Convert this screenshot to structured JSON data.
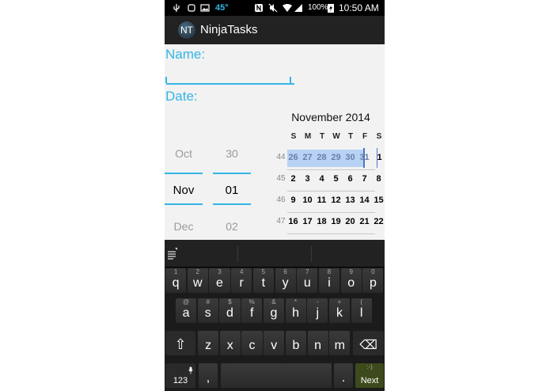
{
  "status_bar": {
    "temperature": "45°",
    "battery": "100%",
    "time": "10:50 AM",
    "icons": [
      "usb-icon",
      "image-icon",
      "nfc-icon",
      "mute-icon",
      "wifi-icon",
      "signal-icon",
      "battery-charging-icon"
    ]
  },
  "action_bar": {
    "icon_text": "NT",
    "title": "NinjaTasks"
  },
  "form": {
    "name_label": "Name:",
    "name_value": "",
    "date_label": "Date:"
  },
  "date_picker": {
    "month": {
      "prev": "Oct",
      "current": "Nov",
      "next": "Dec"
    },
    "day": {
      "prev": "30",
      "current": "01",
      "next": "02"
    }
  },
  "calendar": {
    "title": "November 2014",
    "weekdays": [
      "S",
      "M",
      "T",
      "W",
      "T",
      "F",
      "S"
    ],
    "weeks": [
      {
        "num": "44",
        "days": [
          "26",
          "27",
          "28",
          "29",
          "30",
          "31",
          "1"
        ]
      },
      {
        "num": "45",
        "days": [
          "2",
          "3",
          "4",
          "5",
          "6",
          "7",
          "8"
        ]
      },
      {
        "num": "46",
        "days": [
          "9",
          "10",
          "11",
          "12",
          "13",
          "14",
          "15"
        ]
      },
      {
        "num": "47",
        "days": [
          "16",
          "17",
          "18",
          "19",
          "20",
          "21",
          "22"
        ]
      }
    ],
    "selected_day": "1"
  },
  "keyboard": {
    "row1": [
      {
        "k": "q",
        "a": "1"
      },
      {
        "k": "w",
        "a": "2"
      },
      {
        "k": "e",
        "a": "3"
      },
      {
        "k": "r",
        "a": "4"
      },
      {
        "k": "t",
        "a": "5"
      },
      {
        "k": "y",
        "a": "6"
      },
      {
        "k": "u",
        "a": "7"
      },
      {
        "k": "i",
        "a": "8"
      },
      {
        "k": "o",
        "a": "9"
      },
      {
        "k": "p",
        "a": "0"
      }
    ],
    "row2": [
      {
        "k": "a",
        "a": "@"
      },
      {
        "k": "s",
        "a": "#"
      },
      {
        "k": "d",
        "a": "$"
      },
      {
        "k": "f",
        "a": "%"
      },
      {
        "k": "g",
        "a": "&"
      },
      {
        "k": "h",
        "a": "*"
      },
      {
        "k": "j",
        "a": "-"
      },
      {
        "k": "k",
        "a": "+"
      },
      {
        "k": "l",
        "a": "("
      }
    ],
    "row3": [
      {
        "k": "z",
        "a": ""
      },
      {
        "k": "x",
        "a": ""
      },
      {
        "k": "c",
        "a": ""
      },
      {
        "k": "v",
        "a": ""
      },
      {
        "k": "b",
        "a": ""
      },
      {
        "k": "n",
        "a": ""
      },
      {
        "k": "m",
        "a": ""
      }
    ],
    "shift": "⇧",
    "backspace": "⌫",
    "symbols": "123",
    "comma": ",",
    "period": ".",
    "next": "Next",
    "next_alt": ":-)"
  }
}
